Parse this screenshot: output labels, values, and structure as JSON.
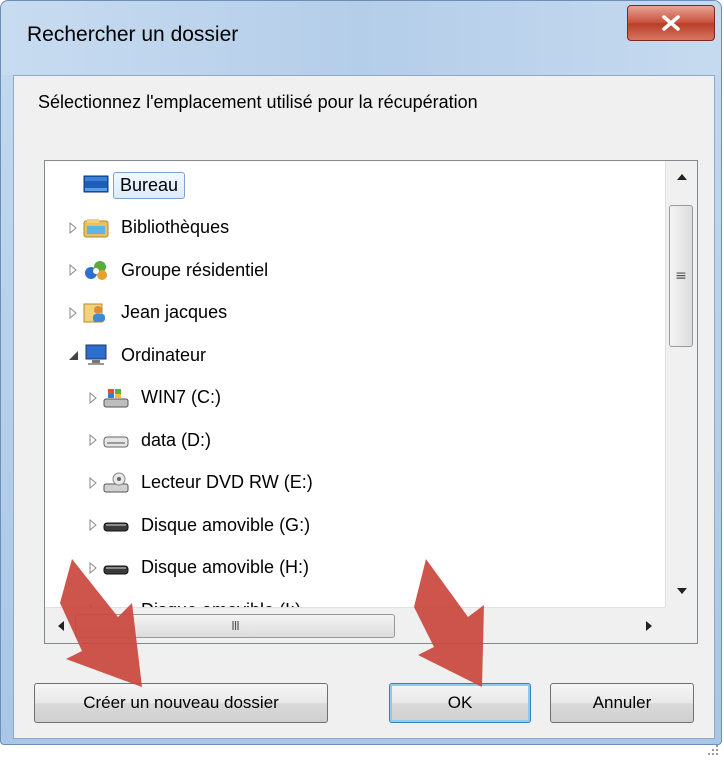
{
  "window": {
    "title": "Rechercher un dossier",
    "close_label": "x"
  },
  "instruction": "Sélectionnez l'emplacement utilisé pour la récupération",
  "tree": {
    "items": [
      {
        "label": "Bureau",
        "icon": "desktop-icon",
        "level": 0,
        "expander": "none",
        "selected": true
      },
      {
        "label": "Bibliothèques",
        "icon": "libraries-icon",
        "level": 0,
        "expander": "collapsed"
      },
      {
        "label": "Groupe résidentiel",
        "icon": "homegroup-icon",
        "level": 0,
        "expander": "collapsed"
      },
      {
        "label": "Jean jacques",
        "icon": "user-folder-icon",
        "level": 0,
        "expander": "collapsed"
      },
      {
        "label": "Ordinateur",
        "icon": "computer-icon",
        "level": 0,
        "expander": "expanded"
      },
      {
        "label": "WIN7 (C:)",
        "icon": "system-drive-icon",
        "level": 1,
        "expander": "collapsed"
      },
      {
        "label": "data (D:)",
        "icon": "hard-drive-icon",
        "level": 1,
        "expander": "collapsed"
      },
      {
        "label": "Lecteur DVD RW (E:)",
        "icon": "dvd-drive-icon",
        "level": 1,
        "expander": "collapsed"
      },
      {
        "label": "Disque amovible (G:)",
        "icon": "removable-drive-icon",
        "level": 1,
        "expander": "collapsed"
      },
      {
        "label": "Disque amovible (H:)",
        "icon": "removable-drive-icon",
        "level": 1,
        "expander": "collapsed"
      },
      {
        "label": "Disque amovible (I:)",
        "icon": "removable-drive-icon",
        "level": 1,
        "expander": "collapsed"
      }
    ],
    "hscroll_thumb_glyph": "III",
    "vscroll_thumb_glyph": "≡"
  },
  "buttons": {
    "new_folder": "Créer un nouveau dossier",
    "ok": "OK",
    "cancel": "Annuler"
  },
  "colors": {
    "annotation_arrow": "#c9463d",
    "close_button": "#c7503b",
    "selection": "#dcebfc"
  }
}
